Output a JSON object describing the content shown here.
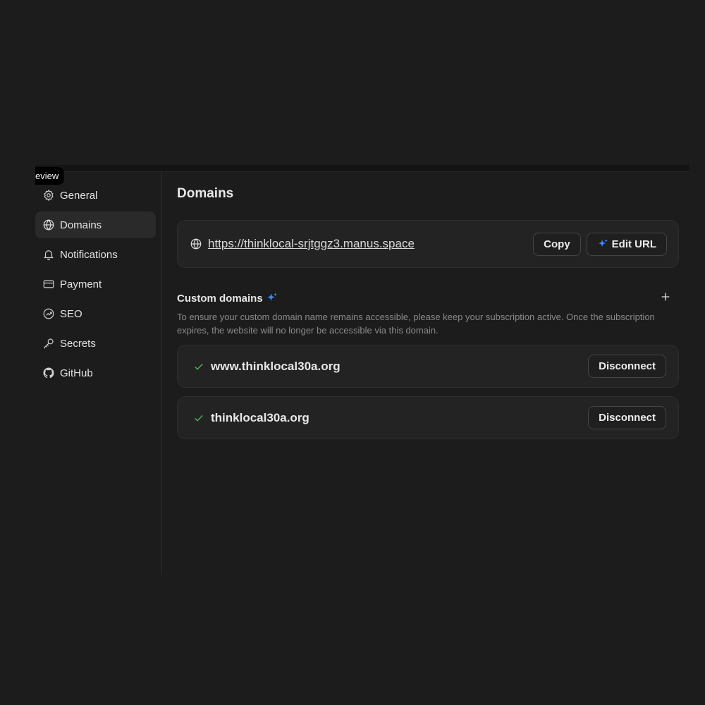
{
  "tooltip": {
    "text": "eview"
  },
  "sidebar": {
    "items": [
      {
        "label": "General",
        "icon": "gear-icon"
      },
      {
        "label": "Domains",
        "icon": "globe-icon",
        "active": true
      },
      {
        "label": "Notifications",
        "icon": "bell-icon"
      },
      {
        "label": "Payment",
        "icon": "credit-card-icon"
      },
      {
        "label": "SEO",
        "icon": "trend-chart-icon"
      },
      {
        "label": "Secrets",
        "icon": "key-icon"
      },
      {
        "label": "GitHub",
        "icon": "github-icon"
      }
    ]
  },
  "main": {
    "title": "Domains",
    "url_card": {
      "url": "https://thinklocal-srjtggz3.manus.space",
      "copy_label": "Copy",
      "edit_label": "Edit URL"
    },
    "custom_domains": {
      "title": "Custom domains",
      "description": "To ensure your custom domain name remains accessible, please keep your subscription active. Once the subscription expires, the website will no longer be accessible via this domain.",
      "items": [
        {
          "domain": "www.thinklocal30a.org",
          "action_label": "Disconnect",
          "status": "connected"
        },
        {
          "domain": "thinklocal30a.org",
          "action_label": "Disconnect",
          "status": "connected"
        }
      ]
    }
  },
  "colors": {
    "background": "#1c1c1c",
    "accent": "#3d8bff",
    "check": "#4caf50"
  }
}
